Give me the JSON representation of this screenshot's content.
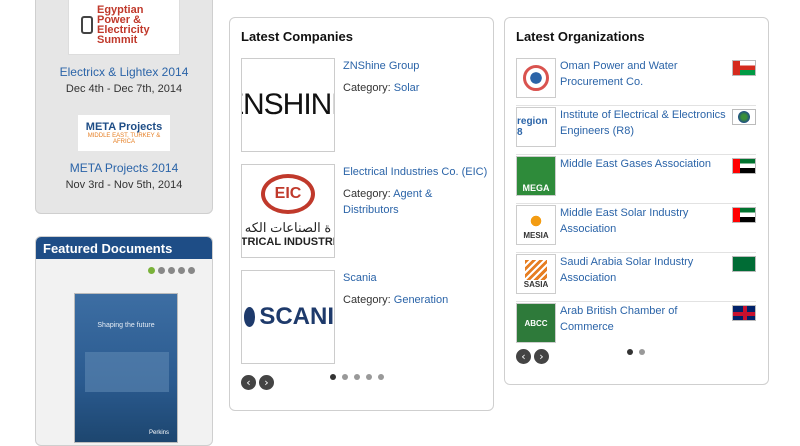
{
  "events": [
    {
      "logo_text": "Egyptian Power & Electricity Summit",
      "title": "Electricx & Lightex 2014",
      "date": "Dec 4th - Dec 7th, 2014"
    },
    {
      "logo_text": "META Projects",
      "logo_sub": "MIDDLE EAST, TURKEY & AFRICA",
      "title": "META Projects 2014",
      "date": "Nov 3rd - Nov 5th, 2014"
    }
  ],
  "featured": {
    "heading": "Featured Documents",
    "cover_title": "Shaping the future",
    "cover_brand": "Perkins"
  },
  "companies": {
    "heading": "Latest Companies",
    "category_label": "Category:",
    "items": [
      {
        "name": "ZNShine Group",
        "category": "Solar",
        "logo_text": "ZNSHINE"
      },
      {
        "name": "Electrical Industries Co. (EIC)",
        "category": "Agent & Distributors",
        "logo_text": "EIC",
        "logo_sub": "ة الصناعات الكه",
        "logo_sub2": "CTRICAL INDUSTRIE"
      },
      {
        "name": "Scania",
        "category": "Generation",
        "logo_text": "SCANI"
      }
    ]
  },
  "organizations": {
    "heading": "Latest Organizations",
    "items": [
      {
        "name": "Oman Power and Water Procurement Co.",
        "logo_text": "",
        "flag": "oman"
      },
      {
        "name": "Institute of Electrical & Electronics Engineers (R8)",
        "logo_text": "region 8",
        "flag": "globe"
      },
      {
        "name": "Middle East Gases Association",
        "logo_text": "MEGA",
        "flag": "uae"
      },
      {
        "name": "Middle East Solar Industry Association",
        "logo_text": "MESIA",
        "flag": "uae"
      },
      {
        "name": "Saudi Arabia Solar Industry Association",
        "logo_text": "SASIA",
        "flag": "saudi"
      },
      {
        "name": "Arab British Chamber of Commerce",
        "logo_text": "ABCC",
        "flag": "uk"
      }
    ]
  }
}
